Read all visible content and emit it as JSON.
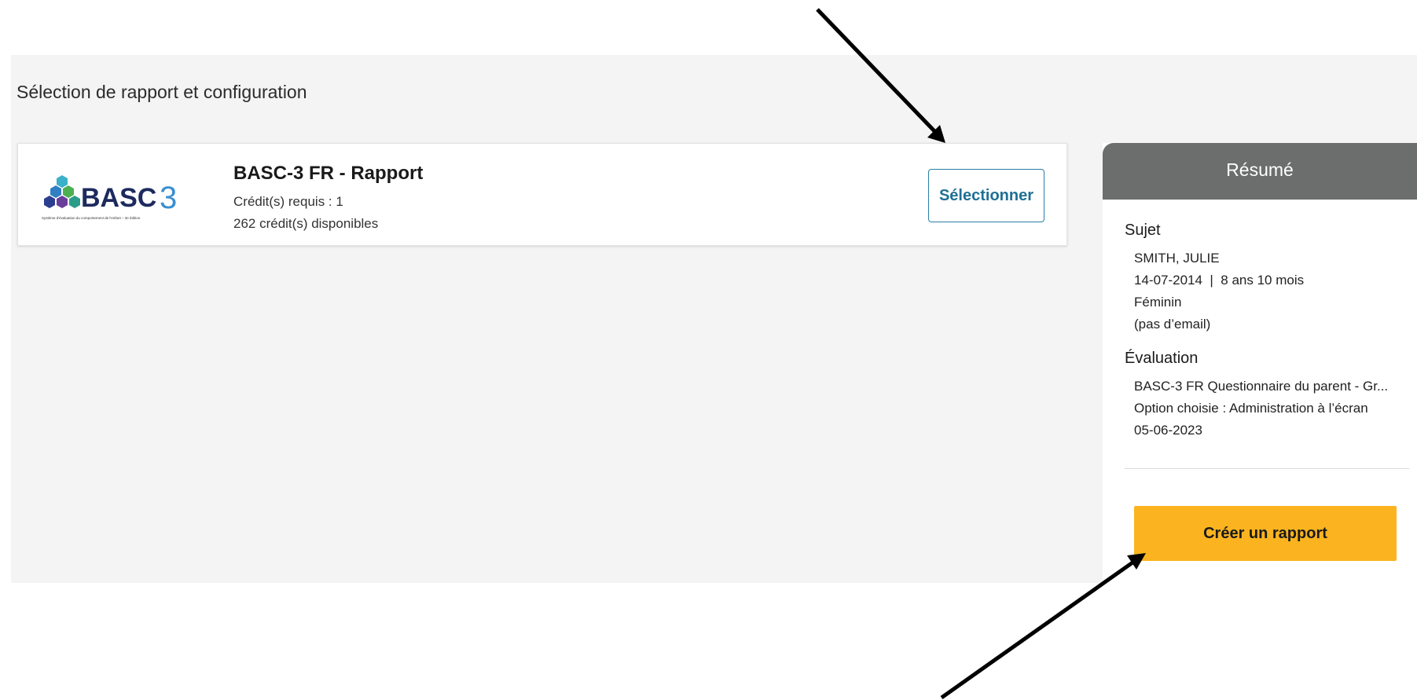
{
  "page": {
    "title": "Sélection de rapport et configuration"
  },
  "report_card": {
    "logo": {
      "name": "BASC-3 logo",
      "wordmark": "BASC3",
      "tagline": "Système d'évaluation du comportement de l'enfant – 3e édition"
    },
    "title": "BASC-3 FR - Rapport",
    "credits_required": "Crédit(s) requis : 1",
    "credits_available": "262 crédit(s) disponibles",
    "select_label": "Sélectionner"
  },
  "summary": {
    "header": "Résumé",
    "subject": {
      "label": "Sujet",
      "name": "SMITH, JULIE",
      "dob_age": "14-07-2014  |  8 ans 10 mois",
      "gender": "Féminin",
      "email": "(pas d’email)"
    },
    "evaluation": {
      "label": "Évaluation",
      "form": "BASC-3 FR Questionnaire du parent - Gr...",
      "option": "Option choisie : Administration à l’écran",
      "date": "05-06-2023"
    },
    "create_label": "Créer un rapport"
  },
  "colors": {
    "accent_button": "#fbb41f",
    "select_border": "#2a7ea6",
    "summary_header": "#6b6e6c",
    "page_background": "#f4f4f4"
  }
}
